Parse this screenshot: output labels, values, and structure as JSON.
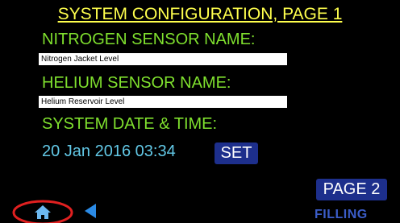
{
  "title": "SYSTEM CONFIGURATION, PAGE 1",
  "nitrogen": {
    "label": "NITROGEN SENSOR NAME:",
    "value": "Nitrogen Jacket Level"
  },
  "helium": {
    "label": "HELIUM SENSOR NAME:",
    "value": "Helium Reservoir Level"
  },
  "datetime": {
    "label": "SYSTEM DATE & TIME:",
    "value": "20 Jan 2016 03:34",
    "set_label": "SET"
  },
  "page2_label": "PAGE 2",
  "status": "FILLING",
  "icons": {
    "home": "home-icon",
    "back": "back-arrow-icon"
  },
  "colors": {
    "background": "#000000",
    "title": "#ffff4d",
    "label": "#7fe02e",
    "datetime": "#62c8e6",
    "button": "#1d2f8c",
    "status": "#3b5dc9",
    "highlight_ring": "#e02020"
  }
}
